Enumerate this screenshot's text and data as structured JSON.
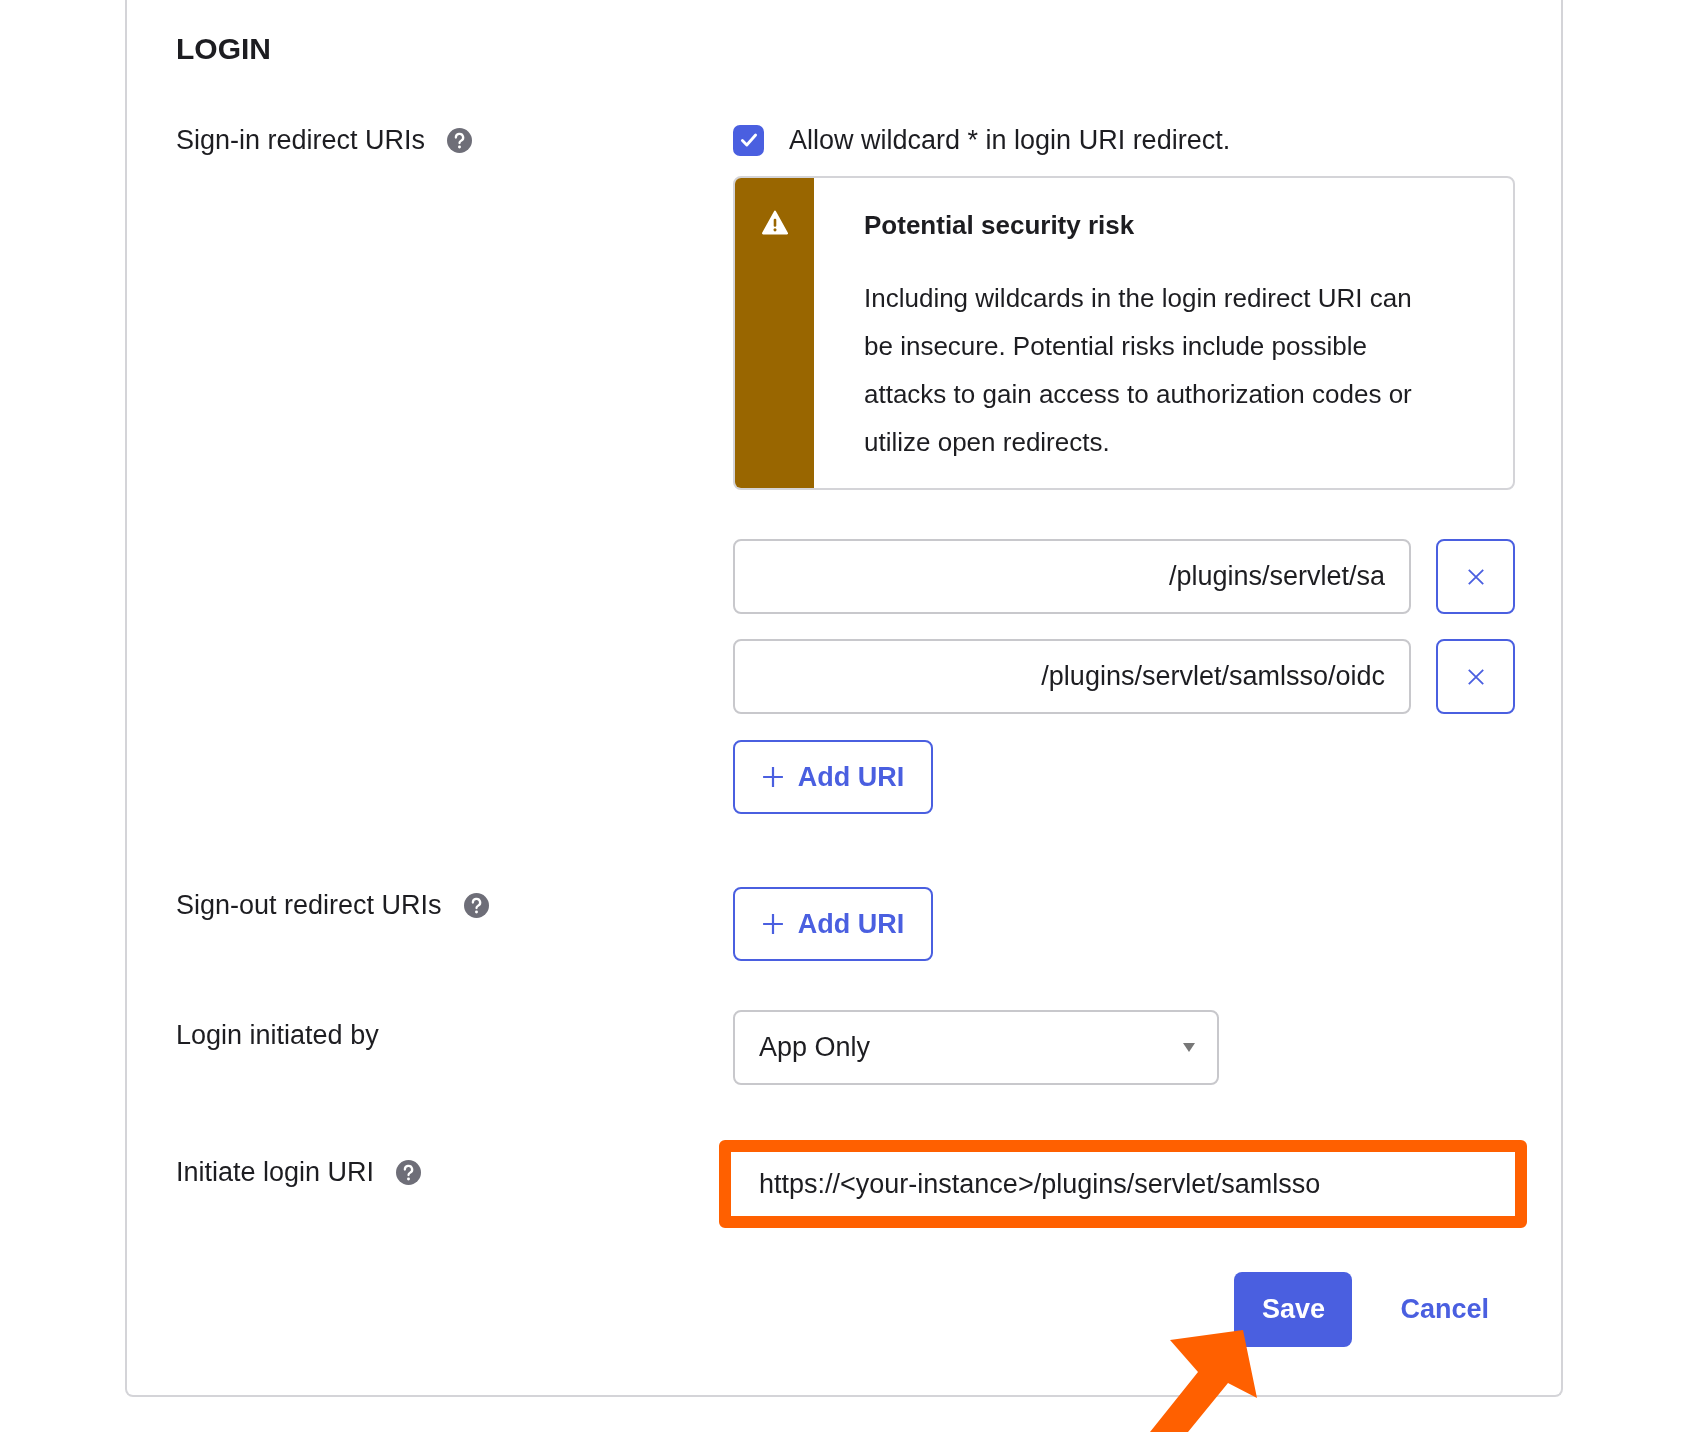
{
  "section": {
    "title": "LOGIN"
  },
  "sign_in": {
    "label": "Sign-in redirect URIs",
    "help": true,
    "wildcard": {
      "label": "Allow wildcard * in login URI redirect.",
      "checked": true
    },
    "warning": {
      "title": "Potential security risk",
      "text": "Including wildcards in the login redirect URI can be insecure. Potential risks include possible attacks to gain access to authorization codes or utilize open redirects."
    },
    "uris": [
      {
        "value": "/plugins/servlet/sa"
      },
      {
        "value": "/plugins/servlet/samlsso/oidc"
      }
    ],
    "add_button": "Add URI"
  },
  "sign_out": {
    "label": "Sign-out redirect URIs",
    "help": true,
    "add_button": "Add URI"
  },
  "login_initiated_by": {
    "label": "Login initiated by",
    "value": "App Only"
  },
  "initiate_login_uri": {
    "label": "Initiate login URI",
    "help": true,
    "value": "https://<your-instance>/plugins/servlet/samlsso",
    "highlighted": true
  },
  "buttons": [
    {
      "label": "Save",
      "kind": "primary"
    },
    {
      "label": "Cancel",
      "kind": "link"
    }
  ],
  "arrow_annotation": true
}
